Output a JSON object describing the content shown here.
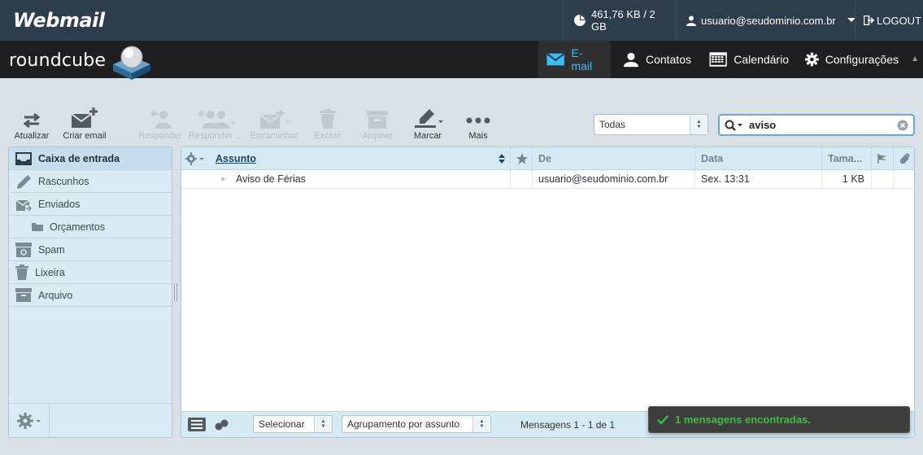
{
  "topbar": {
    "brand": "Webmail",
    "quota": "461,76 KB / 2 GB",
    "user": "usuario@seudominio.com.br",
    "logout": "LOGOUT"
  },
  "header": {
    "logo": "roundcube",
    "tabs": [
      {
        "label": "E-mail",
        "icon": "envelope-icon",
        "active": true
      },
      {
        "label": "Contatos",
        "icon": "person-icon"
      },
      {
        "label": "Calendário",
        "icon": "calendar-icon"
      },
      {
        "label": "Configurações",
        "icon": "gear-icon"
      }
    ]
  },
  "toolbar": {
    "refresh": "Atualizar",
    "compose": "Criar email",
    "reply": "Responder",
    "reply_all": "Responder ...",
    "forward": "Encaminhar",
    "delete": "Excluir",
    "archive": "Arquivo",
    "mark": "Marcar",
    "more": "Mais"
  },
  "search": {
    "scope": "Todas",
    "query": "aviso"
  },
  "folders": [
    {
      "label": "Caixa de entrada",
      "icon": "inbox-icon",
      "selected": true
    },
    {
      "label": "Rascunhos",
      "icon": "pencil-icon"
    },
    {
      "label": "Enviados",
      "icon": "sent-icon"
    },
    {
      "label": "Orçamentos",
      "icon": "folder-icon",
      "sub": true
    },
    {
      "label": "Spam",
      "icon": "spam-icon"
    },
    {
      "label": "Lixeira",
      "icon": "trash-icon"
    },
    {
      "label": "Arquivo",
      "icon": "archive-icon"
    }
  ],
  "list": {
    "columns": {
      "subject": "Assunto",
      "from": "De",
      "date": "Data",
      "size": "Tama..."
    },
    "rows": [
      {
        "subject": "Aviso de Férias",
        "from": "usuario@seudominio.com.br",
        "date": "Sex. 13:31",
        "size": "1 KB"
      }
    ],
    "footer": {
      "select": "Selecionar",
      "threading": "Agrupamento por assunto",
      "count": "Mensagens 1 - 1 de 1"
    }
  },
  "notice": "1 mensagens encontradas.",
  "colors": {
    "topbar": "#2e3d4c",
    "header": "#1f1f1f",
    "accent": "#37beff",
    "success": "#38c23b"
  }
}
